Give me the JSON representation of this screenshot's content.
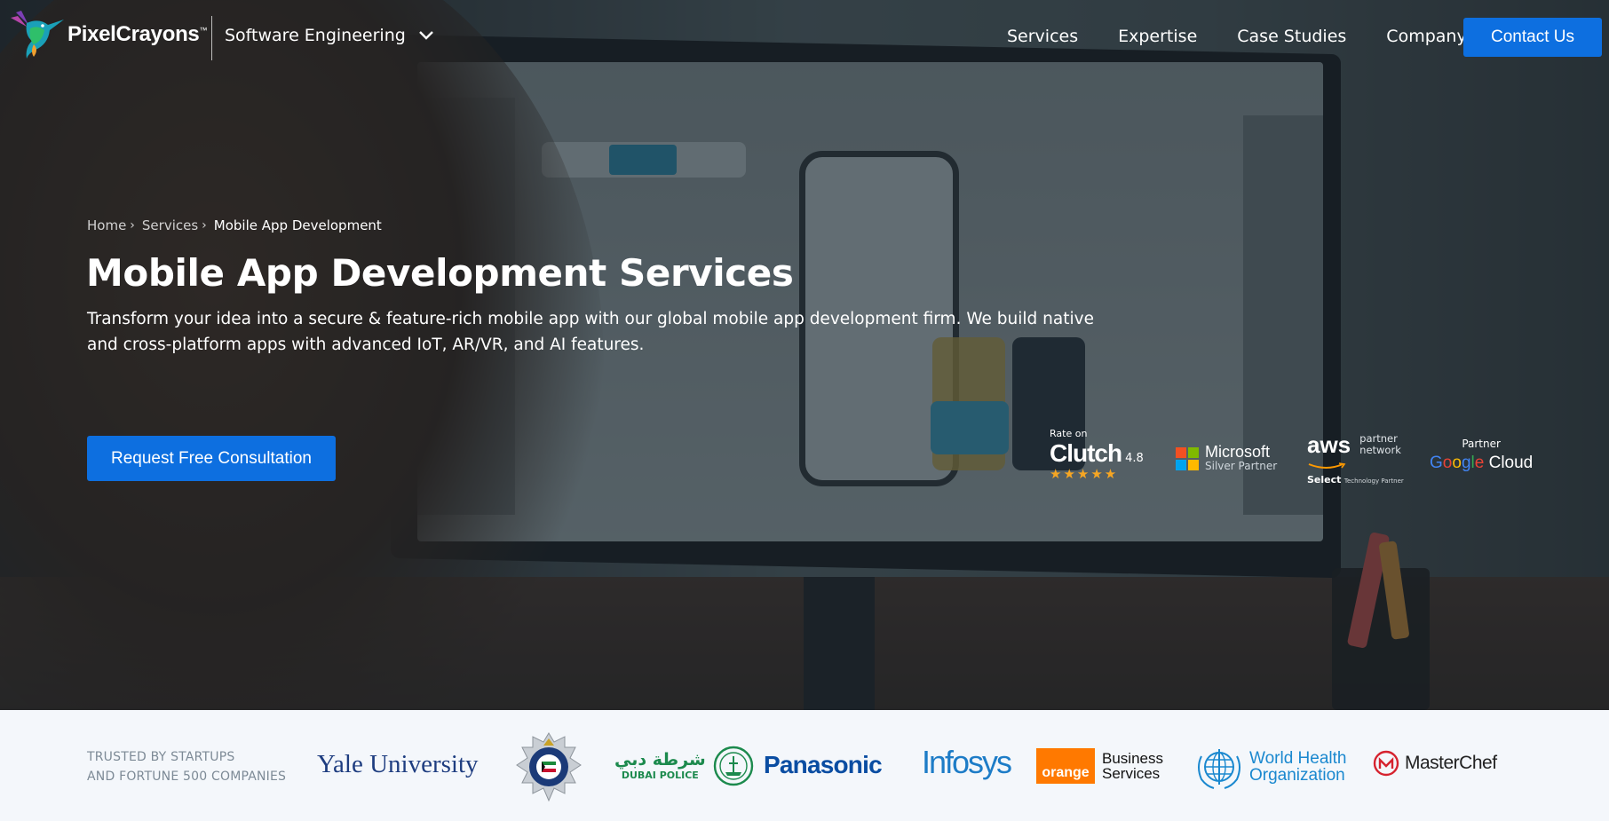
{
  "header": {
    "brand": "PixelCrayons",
    "brand_tm": "™",
    "division": "Software Engineering",
    "nav": [
      "Services",
      "Expertise",
      "Case Studies",
      "Company"
    ],
    "contact_label": "Contact Us"
  },
  "breadcrumb": {
    "items": [
      "Home",
      "Services",
      "Mobile App Development"
    ]
  },
  "hero": {
    "title": "Mobile App Development Services",
    "description": "Transform your idea into a secure & feature-rich mobile app with our global mobile app development firm. We build native and cross-platform apps with advanced IoT, AR/VR, and AI features.",
    "cta_label": "Request Free Consultation"
  },
  "badges": {
    "clutch": {
      "rate_on": "Rate on",
      "name": "Clutch",
      "score": "4.8",
      "stars": "★★★★★"
    },
    "microsoft": {
      "name": "Microsoft",
      "tier": "Silver Partner"
    },
    "aws": {
      "name": "aws",
      "line1": "partner",
      "line2": "network",
      "select": "Select",
      "small": "Technology Partner"
    },
    "google": {
      "partner": "Partner",
      "w1": "G",
      "w2": "o",
      "w3": "o",
      "w4": "g",
      "w5": "l",
      "w6": "e",
      "cloud": "Cloud"
    }
  },
  "trust": {
    "label_line1": "TRUSTED BY STARTUPS",
    "label_line2": "AND FORTUNE 500 COMPANIES",
    "yale": "Yale University",
    "kuwait": "KUWAIT POLICE",
    "dubai_ar": "شرطة دبي",
    "dubai_en": "DUBAI POLICE",
    "panasonic": "Panasonic",
    "infosys": "Infosys",
    "orange": "orange",
    "orange_line1": "Business",
    "orange_line2": "Services",
    "who_line1": "World Health",
    "who_line2": "Organization",
    "masterchef": "MasterChef"
  },
  "colors": {
    "accent": "#0d6fe0",
    "trust_bg": "#f4f7fb"
  }
}
